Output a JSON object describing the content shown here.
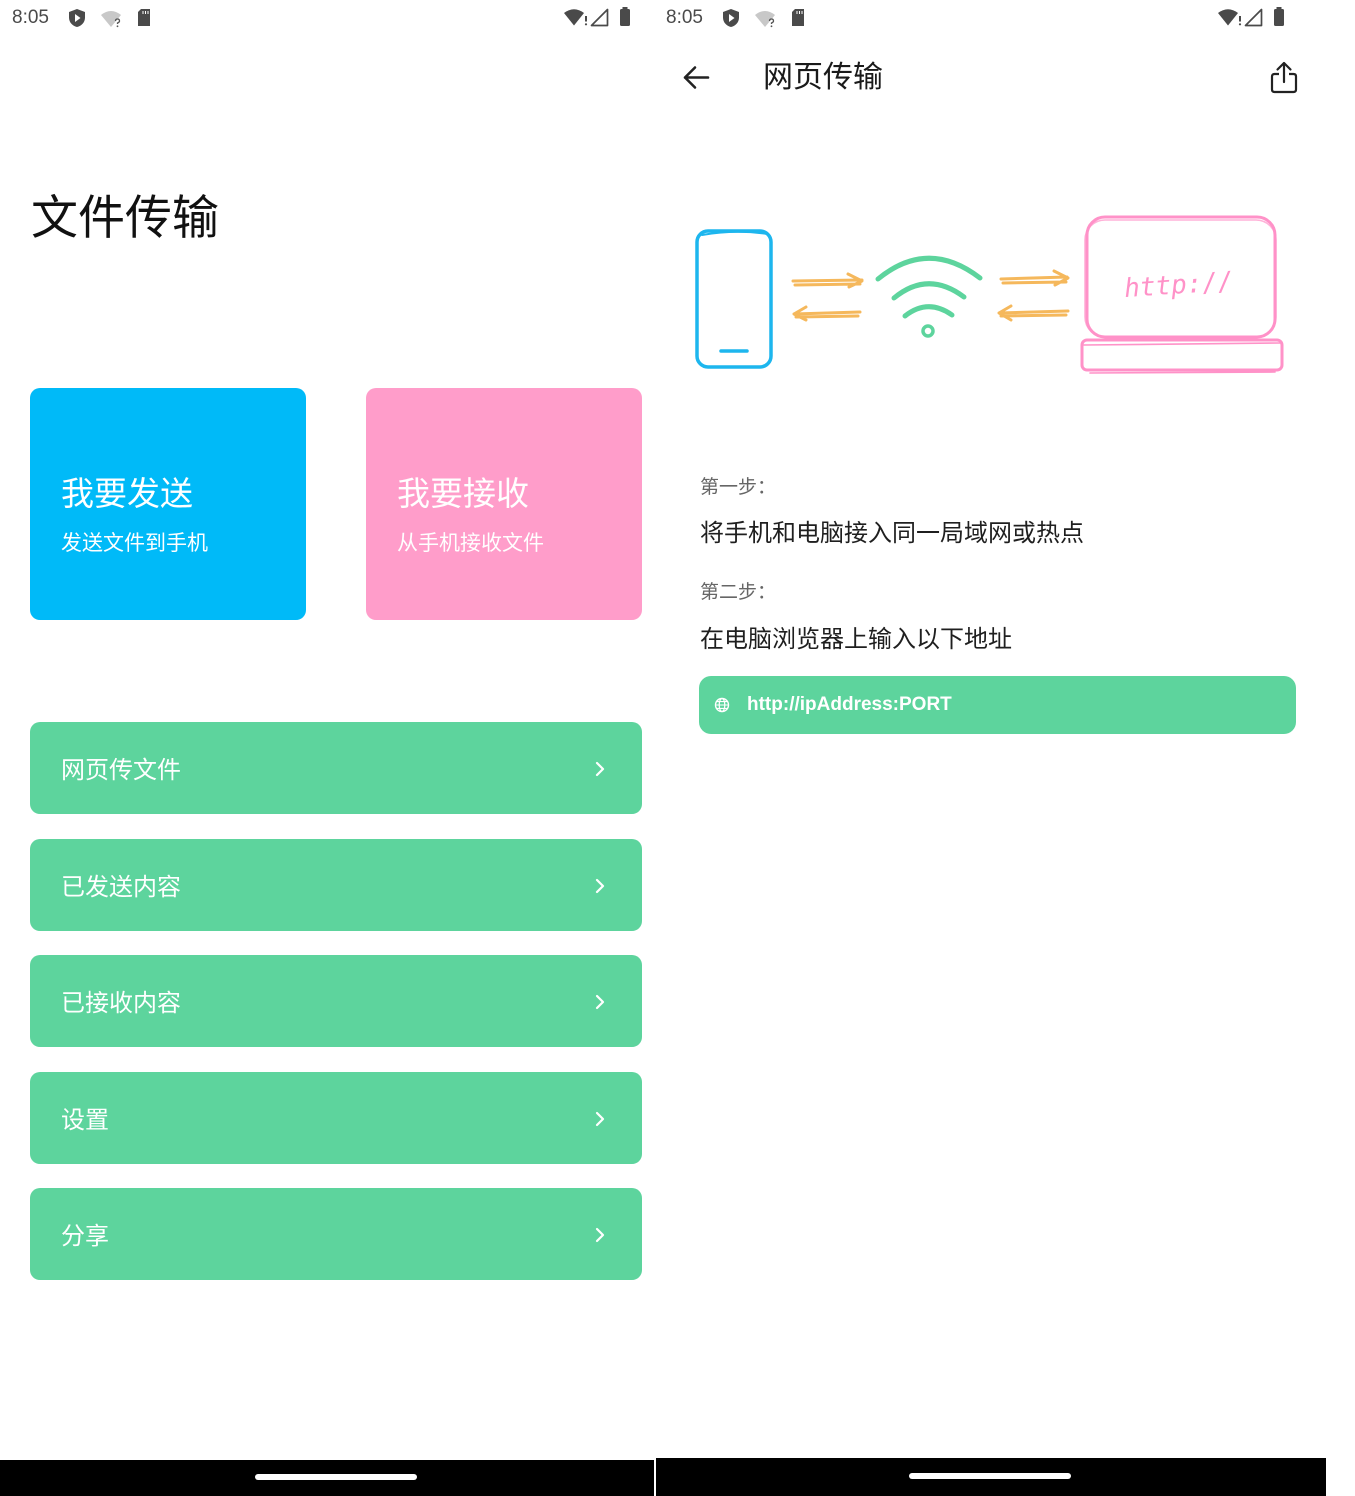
{
  "colors": {
    "send_card": "#00BAF8",
    "receive_card": "#FF9DCA",
    "menu_item": "#5DD49D",
    "address_box": "#5DD49D",
    "illustration_phone": "#1DB6EE",
    "illustration_arrows": "#F5B85C",
    "illustration_wifi": "#5DD49D",
    "illustration_laptop": "#FF92C8"
  },
  "left_screen": {
    "status_bar": {
      "time": "8:05",
      "icons_left": [
        "shield-icon",
        "wifi-unknown-icon",
        "sd-card-icon"
      ],
      "icons_right": [
        "wifi-alert-icon",
        "signal-icon",
        "battery-icon"
      ]
    },
    "page_title": "文件传输",
    "cards": [
      {
        "title": "我要发送",
        "subtitle": "发送文件到手机"
      },
      {
        "title": "我要接收",
        "subtitle": "从手机接收文件"
      }
    ],
    "menu": [
      {
        "label": "网页传文件",
        "icon": "chevron-right-icon"
      },
      {
        "label": "已发送内容",
        "icon": "chevron-right-icon"
      },
      {
        "label": "已接收内容",
        "icon": "chevron-right-icon"
      },
      {
        "label": "设置",
        "icon": "chevron-right-icon"
      },
      {
        "label": "分享",
        "icon": "chevron-right-icon"
      }
    ]
  },
  "right_screen": {
    "status_bar": {
      "time": "8:05",
      "icons_left": [
        "shield-icon",
        "wifi-unknown-icon",
        "sd-card-icon"
      ],
      "icons_right": [
        "wifi-alert-icon",
        "signal-icon",
        "battery-icon"
      ]
    },
    "app_bar": {
      "title": "网页传输",
      "back_icon": "arrow-back-icon",
      "action_icon": "share-icon"
    },
    "illustration": {
      "laptop_text": "http://"
    },
    "steps": [
      {
        "label": "第一步：",
        "text": "将手机和电脑接入同一局域网或热点"
      },
      {
        "label": "第二步：",
        "text": "在电脑浏览器上输入以下地址"
      }
    ],
    "address": {
      "icon": "globe-icon",
      "text": "http://ipAddress:PORT"
    }
  }
}
